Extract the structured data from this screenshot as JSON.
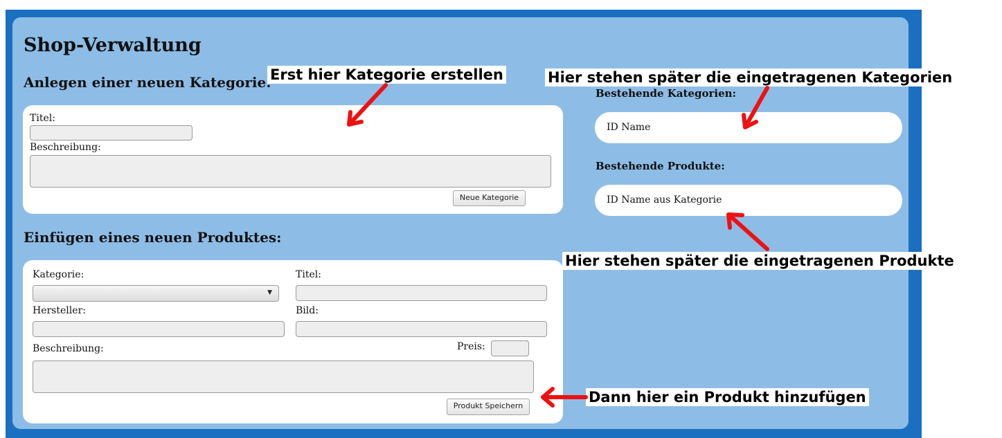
{
  "app": {
    "title": "Shop-Verwaltung"
  },
  "category_form": {
    "heading": "Anlegen einer neuen Kategorie:",
    "title_label": "Titel:",
    "title_value": "",
    "description_label": "Beschreibung:",
    "description_value": "",
    "submit_label": "Neue Kategorie"
  },
  "product_form": {
    "heading": "Einfügen eines neuen Produktes:",
    "category_label": "Kategorie:",
    "category_selected": "",
    "title_label": "Titel:",
    "title_value": "",
    "manufacturer_label": "Hersteller:",
    "manufacturer_value": "",
    "image_label": "Bild:",
    "image_value": "",
    "description_label": "Beschreibung:",
    "description_value": "",
    "price_label": "Preis:",
    "price_value": "",
    "submit_label": "Produkt Speichern"
  },
  "existing_categories": {
    "heading": "Bestehende Kategorien:",
    "row_text": "ID Name"
  },
  "existing_products": {
    "heading": "Bestehende Produkte:",
    "row_text": "ID Name aus Kategorie"
  },
  "annotations": {
    "create_category": "Erst hier Kategorie erstellen",
    "categories_list": "Hier stehen später die eingetragenen Kategorien",
    "products_list": "Hier stehen später die eingetragenen Produkte",
    "add_product": "Dann hier ein Produkt hinzufügen"
  },
  "colors": {
    "frame": "#1a6fc1",
    "panel": "#8dbde6",
    "annotation_arrow": "#ee1111"
  }
}
